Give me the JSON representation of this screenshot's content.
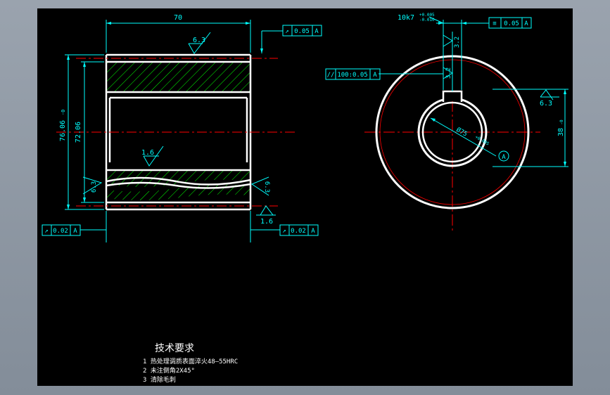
{
  "colors": {
    "background": "#000000",
    "outline": "#ffffff",
    "dimension": "#00ffff",
    "centerline": "#ff0000",
    "hatch": "#00ff00",
    "frame": "#8f99a6"
  },
  "front_view": {
    "width_dim": "70",
    "outer_dim": "76.06",
    "outer_tol": "-0",
    "inner_dim": "72.06",
    "rough_top": "6.3",
    "rough_inner": "1.6",
    "rough_left": "6.3",
    "rough_right": "6.3",
    "rough_bottom": "1.6",
    "tol_top_symbol": "↗",
    "tol_top_value": "0.05",
    "tol_top_datum": "A",
    "tol_left_symbol": "↗",
    "tol_left_value": "0.02",
    "tol_left_datum": "A",
    "tol_right_symbol": "↗",
    "tol_right_value": "0.02",
    "tol_right_datum": "A"
  },
  "side_view": {
    "keyway_fit": "10k7",
    "keyway_fit_upper": "+0.005",
    "keyway_fit_lower": "-0.010",
    "sym_symbol": "≡",
    "sym_value": "0.05",
    "sym_datum": "A",
    "par_symbol": "//",
    "par_value": "100:0.05",
    "par_datum": "A",
    "key_depth": "3.2",
    "key_rough": "3.2",
    "bore_dim": "Ø75",
    "bore_tol": "+0.005",
    "datum_label": "A",
    "outer_dia": "38",
    "outer_dia_tol": "-0",
    "rough_right": "6.3"
  },
  "notes": {
    "title": "技术要求",
    "line1": "1 热处理调质表面淬火48—55HRC",
    "line2": "2 未注倒角2X45°",
    "line3": "3 清除毛刺"
  }
}
